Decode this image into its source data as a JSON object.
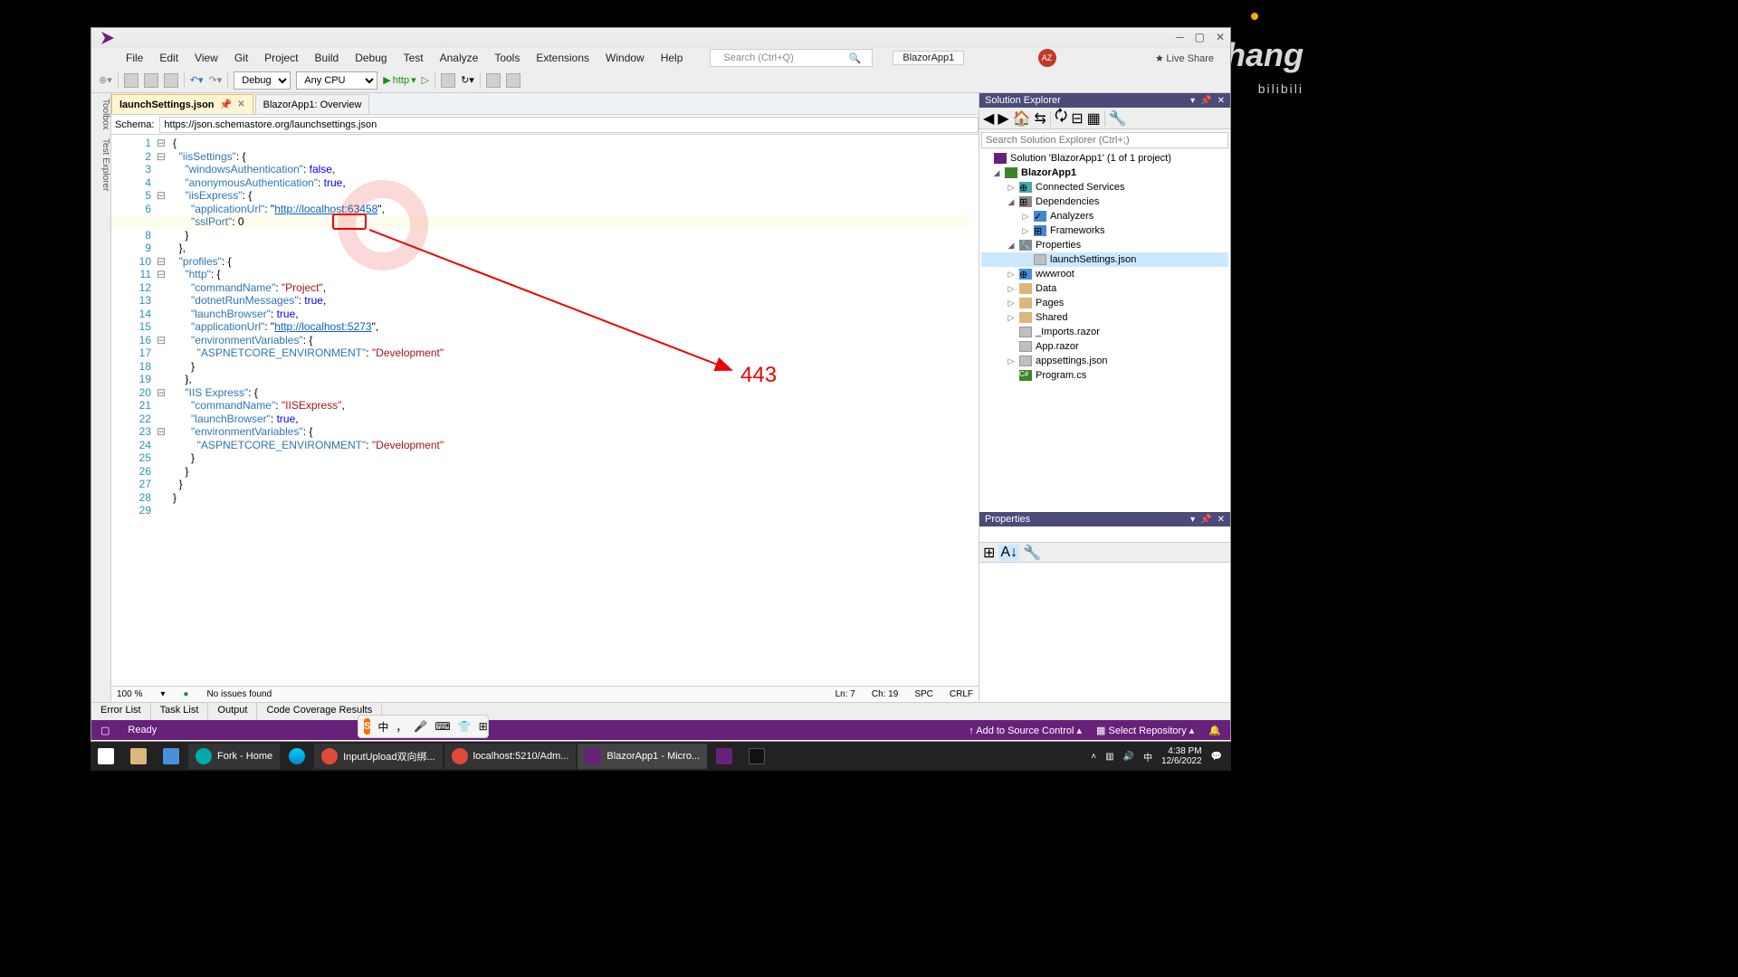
{
  "window": {
    "title": "BlazorApp1",
    "avatar": "AZ"
  },
  "menu": [
    "File",
    "Edit",
    "View",
    "Git",
    "Project",
    "Build",
    "Debug",
    "Test",
    "Analyze",
    "Tools",
    "Extensions",
    "Window",
    "Help"
  ],
  "search": {
    "placeholder": "Search (Ctrl+Q)"
  },
  "toolbar": {
    "config": "Debug",
    "platform": "Any CPU",
    "run": "http"
  },
  "tabs": [
    {
      "label": "launchSettings.json",
      "active": true
    },
    {
      "label": "BlazorApp1: Overview",
      "active": false
    }
  ],
  "schema": {
    "label": "Schema:",
    "value": "https://json.schemastore.org/launchsettings.json"
  },
  "code": {
    "lines": [
      "{",
      "  \"iisSettings\": {",
      "    \"windowsAuthentication\": false,",
      "    \"anonymousAuthentication\": true,",
      "    \"iisExpress\": {",
      "      \"applicationUrl\": \"http://localhost:63458\",",
      "      \"sslPort\": 0",
      "    }",
      "  },",
      "  \"profiles\": {",
      "    \"http\": {",
      "      \"commandName\": \"Project\",",
      "      \"dotnetRunMessages\": true,",
      "      \"launchBrowser\": true,",
      "      \"applicationUrl\": \"http://localhost:5273\",",
      "      \"environmentVariables\": {",
      "        \"ASPNETCORE_ENVIRONMENT\": \"Development\"",
      "      }",
      "    },",
      "    \"IIS Express\": {",
      "      \"commandName\": \"IISExpress\",",
      "      \"launchBrowser\": true,",
      "      \"environmentVariables\": {",
      "        \"ASPNETCORE_ENVIRONMENT\": \"Development\"",
      "      }",
      "    }",
      "  }",
      "}",
      ""
    ]
  },
  "annotation": {
    "text": "443"
  },
  "editor_status": {
    "zoom": "100 %",
    "issues": "No issues found",
    "ln": "Ln: 7",
    "ch": "Ch: 19",
    "enc": "SPC",
    "eol": "CRLF"
  },
  "bottom_tabs": [
    "Error List",
    "Task List",
    "Output",
    "Code Coverage Results"
  ],
  "statusbar": {
    "ready": "Ready",
    "add_sc": "Add to Source Control",
    "select_repo": "Select Repository"
  },
  "solution_explorer": {
    "title": "Solution Explorer",
    "search_placeholder": "Search Solution Explorer (Ctrl+;)",
    "root": "Solution 'BlazorApp1' (1 of 1 project)",
    "project": "BlazorApp1",
    "nodes": {
      "connected": "Connected Services",
      "deps": "Dependencies",
      "analyzers": "Analyzers",
      "frameworks": "Frameworks",
      "props": "Properties",
      "launch": "launchSettings.json",
      "wwwroot": "wwwroot",
      "data": "Data",
      "pages": "Pages",
      "shared": "Shared",
      "imports": "_Imports.razor",
      "app": "App.razor",
      "appsettings": "appsettings.json",
      "program": "Program.cs"
    }
  },
  "properties": {
    "title": "Properties"
  },
  "left_rail": [
    "Toolbox",
    "Test Explorer"
  ],
  "taskbar": {
    "items": [
      {
        "label": "Fork - Home",
        "color": "#0aa"
      },
      {
        "label": "",
        "color": "#1b74e4"
      },
      {
        "label": "InputUpload双向绑...",
        "color": "#dd4b39"
      },
      {
        "label": "localhost:5210/Adm...",
        "color": "#dd4b39"
      },
      {
        "label": "BlazorApp1 - Micro...",
        "color": "#68217a"
      },
      {
        "label": "",
        "color": "#68217a"
      },
      {
        "label": "",
        "color": "#222"
      }
    ],
    "time": "4:38 PM",
    "date": "12/6/2022"
  },
  "watermark": "ArgoZhang",
  "ime": {
    "lang": "中",
    "punct": "，"
  }
}
